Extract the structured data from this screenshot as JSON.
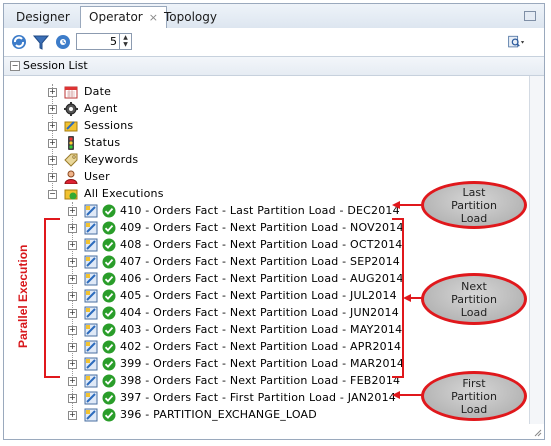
{
  "tabs": [
    {
      "label": "Designer",
      "active": false
    },
    {
      "label": "Operator",
      "active": true,
      "close": "×"
    },
    {
      "label": "Topology",
      "active": false
    }
  ],
  "toolbar": {
    "refresh_icon": "refresh-icon",
    "filter_icon": "filter-icon",
    "auto_refresh_icon": "auto-refresh-icon",
    "count_value": "5",
    "search_icon": "find-icon"
  },
  "session_list": {
    "title": "Session List",
    "nodes": [
      {
        "label": "Date",
        "icon": "calendar-icon"
      },
      {
        "label": "Agent",
        "icon": "gear-icon"
      },
      {
        "label": "Sessions",
        "icon": "sessions-icon"
      },
      {
        "label": "Status",
        "icon": "traffic-light-icon"
      },
      {
        "label": "Keywords",
        "icon": "tag-icon"
      },
      {
        "label": "User",
        "icon": "user-icon"
      },
      {
        "label": "All Executions",
        "icon": "executions-icon"
      }
    ],
    "executions": [
      "410 - Orders Fact - Last Partition Load - DEC2014",
      "409 - Orders Fact - Next Partition Load - NOV2014",
      "408 - Orders Fact - Next Partition Load - OCT2014",
      "407 - Orders Fact - Next Partition Load - SEP2014",
      "406 - Orders Fact - Next Partition Load - AUG2014",
      "405 - Orders Fact - Next Partition Load - JUL2014",
      "404 - Orders Fact - Next Partition Load - JUN2014",
      "403 - Orders Fact - Next Partition Load - MAY2014",
      "402 - Orders Fact - Next Partition Load - APR2014",
      "399 - Orders Fact - Next Partition Load - MAR2014",
      "398 - Orders Fact - Next Partition Load - FEB2014",
      "397 - Orders Fact - First Partition Load - JAN2014",
      "396 - PARTITION_EXCHANGE_LOAD"
    ]
  },
  "annotations": {
    "last": [
      "Last",
      "Partition",
      "Load"
    ],
    "next": [
      "Next",
      "Partition",
      "Load"
    ],
    "first": [
      "First",
      "Partition",
      "Load"
    ],
    "parallel": "Parallel Execution"
  },
  "colors": {
    "annotation_red": "#e0181c",
    "status_green": "#2a9d2a"
  }
}
